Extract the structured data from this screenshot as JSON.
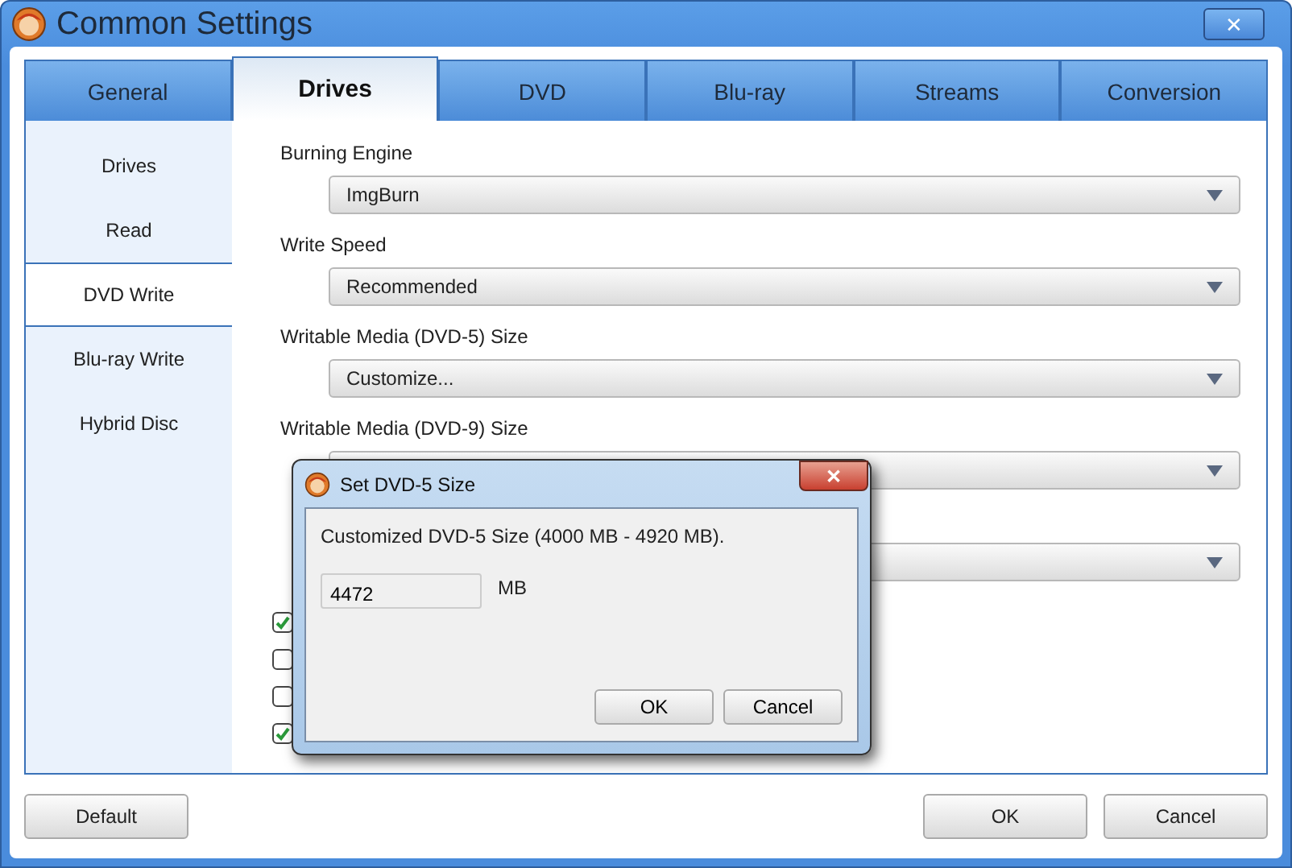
{
  "window": {
    "title": "Common Settings",
    "close": "✕"
  },
  "tabs": [
    {
      "label": "General",
      "selected": false
    },
    {
      "label": "Drives",
      "selected": true
    },
    {
      "label": "DVD",
      "selected": false
    },
    {
      "label": "Blu-ray",
      "selected": false
    },
    {
      "label": "Streams",
      "selected": false
    },
    {
      "label": "Conversion",
      "selected": false
    }
  ],
  "sidebar": {
    "items": [
      {
        "label": "Drives",
        "selected": false
      },
      {
        "label": "Read",
        "selected": false
      },
      {
        "label": "DVD Write",
        "selected": true
      },
      {
        "label": "Blu-ray Write",
        "selected": false
      },
      {
        "label": "Hybrid Disc",
        "selected": false
      }
    ]
  },
  "settings": [
    {
      "kind": "dropdown",
      "label": "Burning Engine",
      "value": "ImgBurn"
    },
    {
      "kind": "dropdown",
      "label": "Write Speed",
      "value": "Recommended"
    },
    {
      "kind": "dropdown",
      "label": "Writable Media (DVD-5) Size",
      "value": "Customize..."
    },
    {
      "kind": "dropdown",
      "label": "Writable Media (DVD-9) Size"
    },
    {
      "kind": "dropdown"
    }
  ],
  "checkboxes": [
    {
      "checked": true
    },
    {
      "checked": false
    },
    {
      "checked": false
    },
    {
      "checked": true
    }
  ],
  "buttons": {
    "left": [
      "Default"
    ],
    "right": [
      "OK",
      "Cancel"
    ]
  },
  "dialog": {
    "title": "Set DVD-5 Size",
    "close": "✕",
    "message": "Customized DVD-5 Size (4000 MB - 4920 MB).",
    "field": {
      "value": "4472"
    },
    "unit": "MB",
    "buttons": [
      "OK",
      "Cancel"
    ]
  }
}
